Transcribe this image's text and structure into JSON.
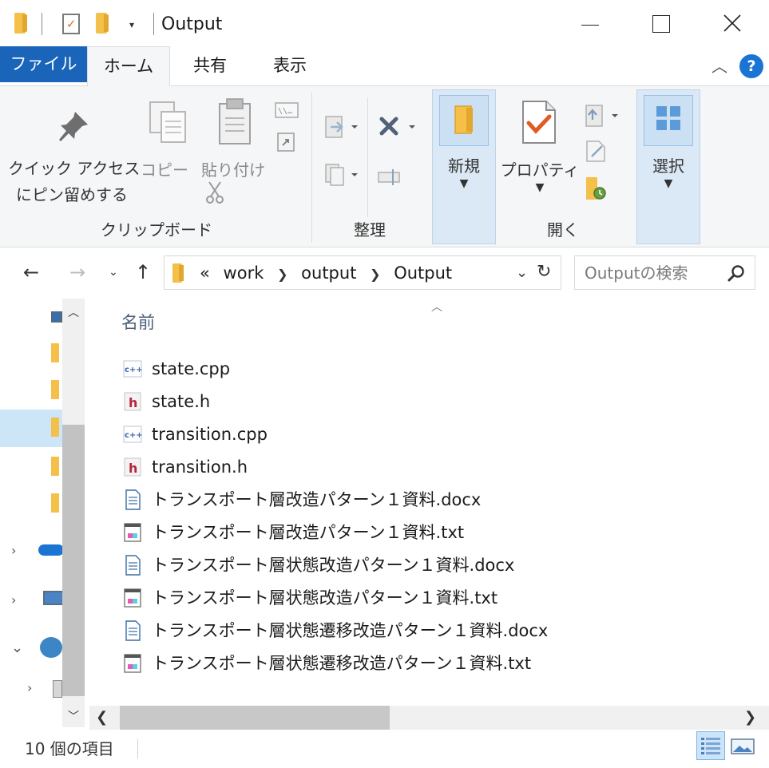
{
  "window": {
    "title": "Output"
  },
  "tabs": {
    "file": "ファイル",
    "home": "ホーム",
    "share": "共有",
    "view": "表示"
  },
  "ribbon": {
    "pin_quick_access_line1": "クイック アクセス",
    "pin_quick_access_line2": "にピン留めする",
    "copy": "コピー",
    "paste": "貼り付け",
    "group_clipboard": "クリップボード",
    "group_organize": "整理",
    "new": "新規",
    "properties": "プロパティ",
    "group_open": "開く",
    "select": "選択"
  },
  "address": {
    "overflow": "«",
    "crumbs": [
      "work",
      "output",
      "Output"
    ]
  },
  "search": {
    "placeholder": "Outputの検索"
  },
  "filelist": {
    "column_name": "名前",
    "files": [
      {
        "name": "state.cpp",
        "icon": "cpp-file-icon"
      },
      {
        "name": "state.h",
        "icon": "h-file-icon"
      },
      {
        "name": "transition.cpp",
        "icon": "cpp-file-icon"
      },
      {
        "name": "transition.h",
        "icon": "h-file-icon"
      },
      {
        "name": "トランスポート層改造パターン１資料.docx",
        "icon": "docx-file-icon"
      },
      {
        "name": "トランスポート層改造パターン１資料.txt",
        "icon": "txt-file-icon"
      },
      {
        "name": "トランスポート層状態改造パターン１資料.docx",
        "icon": "docx-file-icon"
      },
      {
        "name": "トランスポート層状態改造パターン１資料.txt",
        "icon": "txt-file-icon"
      },
      {
        "name": "トランスポート層状態遷移改造パターン１資料.docx",
        "icon": "docx-file-icon"
      },
      {
        "name": "トランスポート層状態遷移改造パターン１資料.txt",
        "icon": "txt-file-icon"
      }
    ]
  },
  "status": {
    "item_count": "10 個の項目"
  },
  "colors": {
    "file_tab": "#1a64b9",
    "help": "#1a74d4",
    "selection": "#cde6f7",
    "folder": "#f4c04a"
  }
}
